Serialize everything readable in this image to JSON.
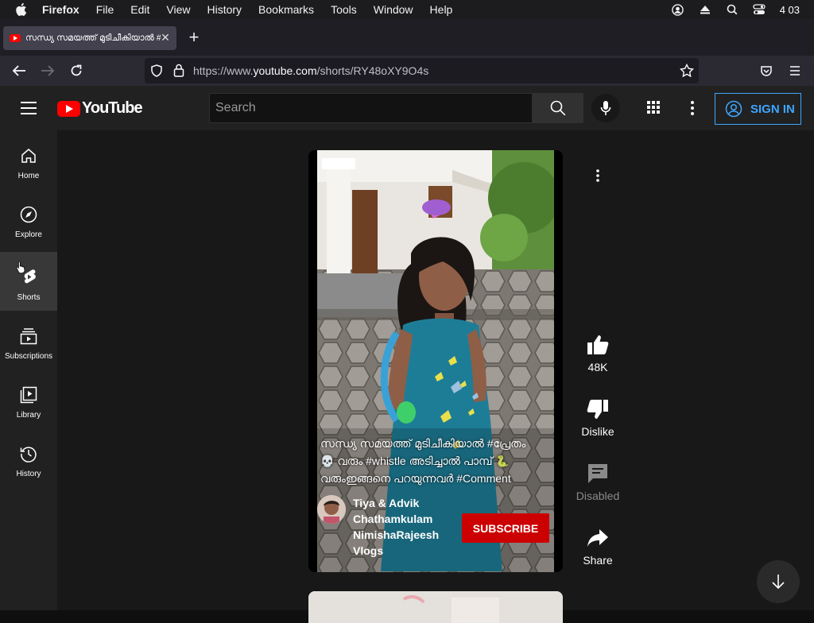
{
  "macos_menu": {
    "app_name": "Firefox",
    "items": [
      "File",
      "Edit",
      "View",
      "History",
      "Bookmarks",
      "Tools",
      "Window",
      "Help"
    ],
    "clock": "4 03"
  },
  "browser": {
    "tab_title": "സന്ധ്യ സമയത്ത് മുടിചീകിയാൽ #പ്രേതം",
    "url_prefix": "https://www.",
    "url_domain": "youtube.com",
    "url_path": "/shorts/RY48oXY9O4s"
  },
  "youtube": {
    "logo_text": "YouTube",
    "search_placeholder": "Search",
    "sign_in_label": "SIGN IN",
    "sidebar": [
      {
        "label": "Home",
        "icon": "home-icon"
      },
      {
        "label": "Explore",
        "icon": "compass-icon"
      },
      {
        "label": "Shorts",
        "icon": "shorts-icon"
      },
      {
        "label": "Subscriptions",
        "icon": "subscriptions-icon"
      },
      {
        "label": "Library",
        "icon": "library-icon"
      },
      {
        "label": "History",
        "icon": "history-icon"
      }
    ],
    "short": {
      "caption_1": "സന്ധ്യ സമയത്ത് മുടിചീകിയാൽ #പ്രേതം",
      "caption_2": "💀 വരും #whistle അടിച്ചാൽ പാമ്പ് 🐍",
      "caption_3": "വരുംഇങ്ങനെ പറയുന്നവർ #Comment",
      "channel_name": "Tiya & Advik Chathamkulam NimishaRajeesh Vlogs",
      "subscribe_label": "SUBSCRIBE"
    },
    "actions": {
      "like_count": "48K",
      "dislike_label": "Dislike",
      "comments_label": "Disabled",
      "share_label": "Share"
    }
  },
  "colors": {
    "brand_red": "#ff0000",
    "subscribe_red": "#cc0000",
    "sign_in_blue": "#3ea6ff"
  }
}
